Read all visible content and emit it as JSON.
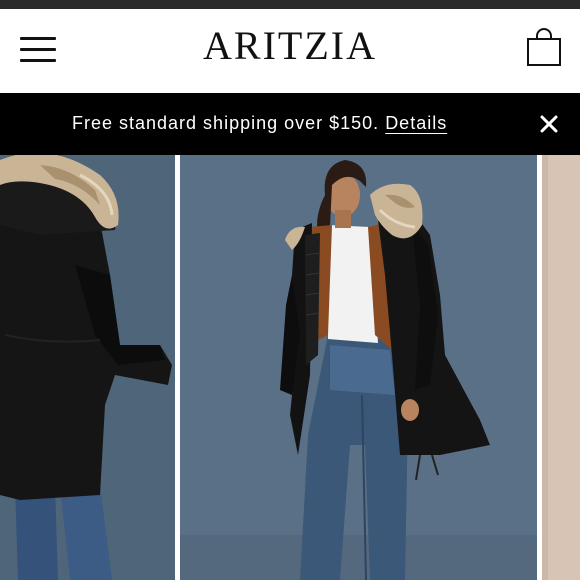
{
  "header": {
    "logo": "ARITZIA",
    "menu_icon": "hamburger-menu-icon",
    "bag_icon": "shopping-bag-icon"
  },
  "banner": {
    "message": "Free standard shipping over $150.",
    "link_label": "Details",
    "close_icon": "close-icon"
  },
  "carousel": {
    "slides": [
      {
        "description_id": "black-parka-back-view"
      },
      {
        "description_id": "black-parka-model-front"
      },
      {
        "description_id": "next-slide-partial"
      }
    ]
  },
  "colors": {
    "banner_bg": "#000000",
    "background_blue": "#5a7086",
    "parka_black": "#141414",
    "fur_trim": "#c9b496",
    "denim": "#3c5878"
  }
}
